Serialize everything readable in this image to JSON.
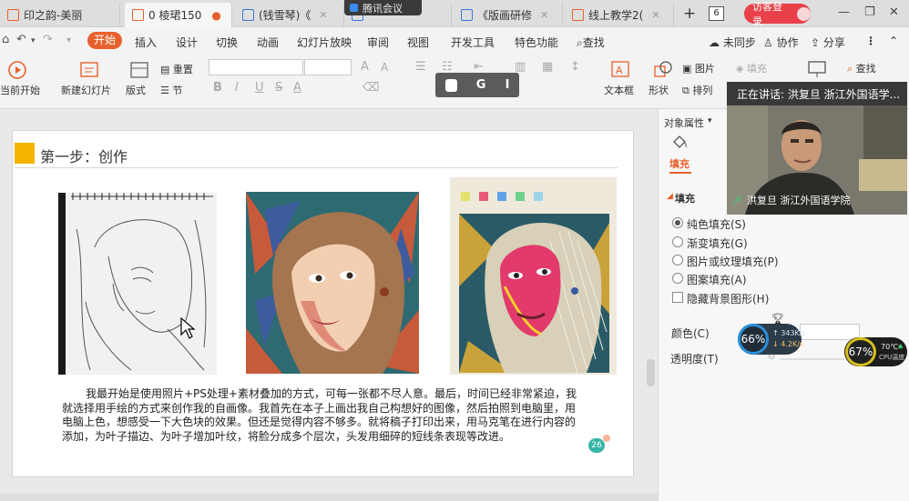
{
  "tabs": [
    {
      "label": "印之韵-美丽",
      "icon": "ppt-icon"
    },
    {
      "label": "0  棱珺150",
      "icon": "ppt-icon"
    },
    {
      "label": "(钱雪琴)《",
      "icon": "word-icon"
    },
    {
      "label": "",
      "icon": "word-icon"
    },
    {
      "label": "《版画研修",
      "icon": "word-icon"
    },
    {
      "label": "线上教学2(",
      "icon": "ppt-icon"
    }
  ],
  "meeting_label": "腾讯会议",
  "tab_count": "6",
  "login_label": "访客登录",
  "menu": {
    "start": "开始",
    "items": [
      "插入",
      "设计",
      "切换",
      "动画",
      "幻灯片放映",
      "审阅",
      "视图",
      "开发工具",
      "特色功能"
    ],
    "search": "查找",
    "sync": "未同步",
    "collab": "协作",
    "share": "分享"
  },
  "ribbon": {
    "from_current": "当前开始",
    "new_slide": "新建幻灯片",
    "layout": "版式",
    "reset": "重置",
    "section": "节",
    "font_btns": [
      "B",
      "I",
      "U",
      "S",
      "A",
      "",
      "A"
    ],
    "textbox": "文本框",
    "shape": "形状",
    "picture": "图片",
    "fill": "填充",
    "arrange": "排列",
    "find": "查找",
    "float_toolbar": [
      "G",
      "I"
    ]
  },
  "slide": {
    "title": "第一步：创作",
    "paragraph": [
      "我最开始是使用照片+PS处理+素材叠加的方式，可每一张都不尽人意。最后，时间已经非常紧迫，我",
      "就选择用手绘的方式来创作我的自画像。我首先在本子上画出我自己构想好的图像，然后拍照到电脑里，用",
      "电脑上色，想感受一下大色块的效果。但还是觉得内容不够多。就将稿子打印出来，用马克笔在进行内容的",
      "添加，为叶子描边、为叶子增加叶纹，将脸分成多个层次，头发用细碎的短线条表现等改进。"
    ],
    "page_number": "26"
  },
  "panel": {
    "object_props": "对象属性",
    "fill_tab": "填充",
    "section_fill": "填充",
    "options": [
      "纯色填充(S)",
      "渐变填充(G)",
      "图片或纹理填充(P)",
      "图案填充(A)"
    ],
    "selected_option": 0,
    "hide_bg": "隐藏背景图形(H)",
    "color_label": "颜色(C)",
    "transparency_label": "透明度(T)",
    "transparency_value": "0%"
  },
  "video": {
    "speaking": "正在讲话: 洪复旦 浙江外国语学...",
    "name": "洪复旦 浙江外国语学院"
  },
  "widgets": {
    "net_percent": "66%",
    "up_speed": "343K/s",
    "down_speed": "4.2K/s",
    "cpu_percent": "67%",
    "cpu_temp": "70℃",
    "cpu_label": "CPU温度"
  },
  "colors": {
    "accent": "#e8602c",
    "login": "#e8414a",
    "title_block": "#f6b400"
  }
}
